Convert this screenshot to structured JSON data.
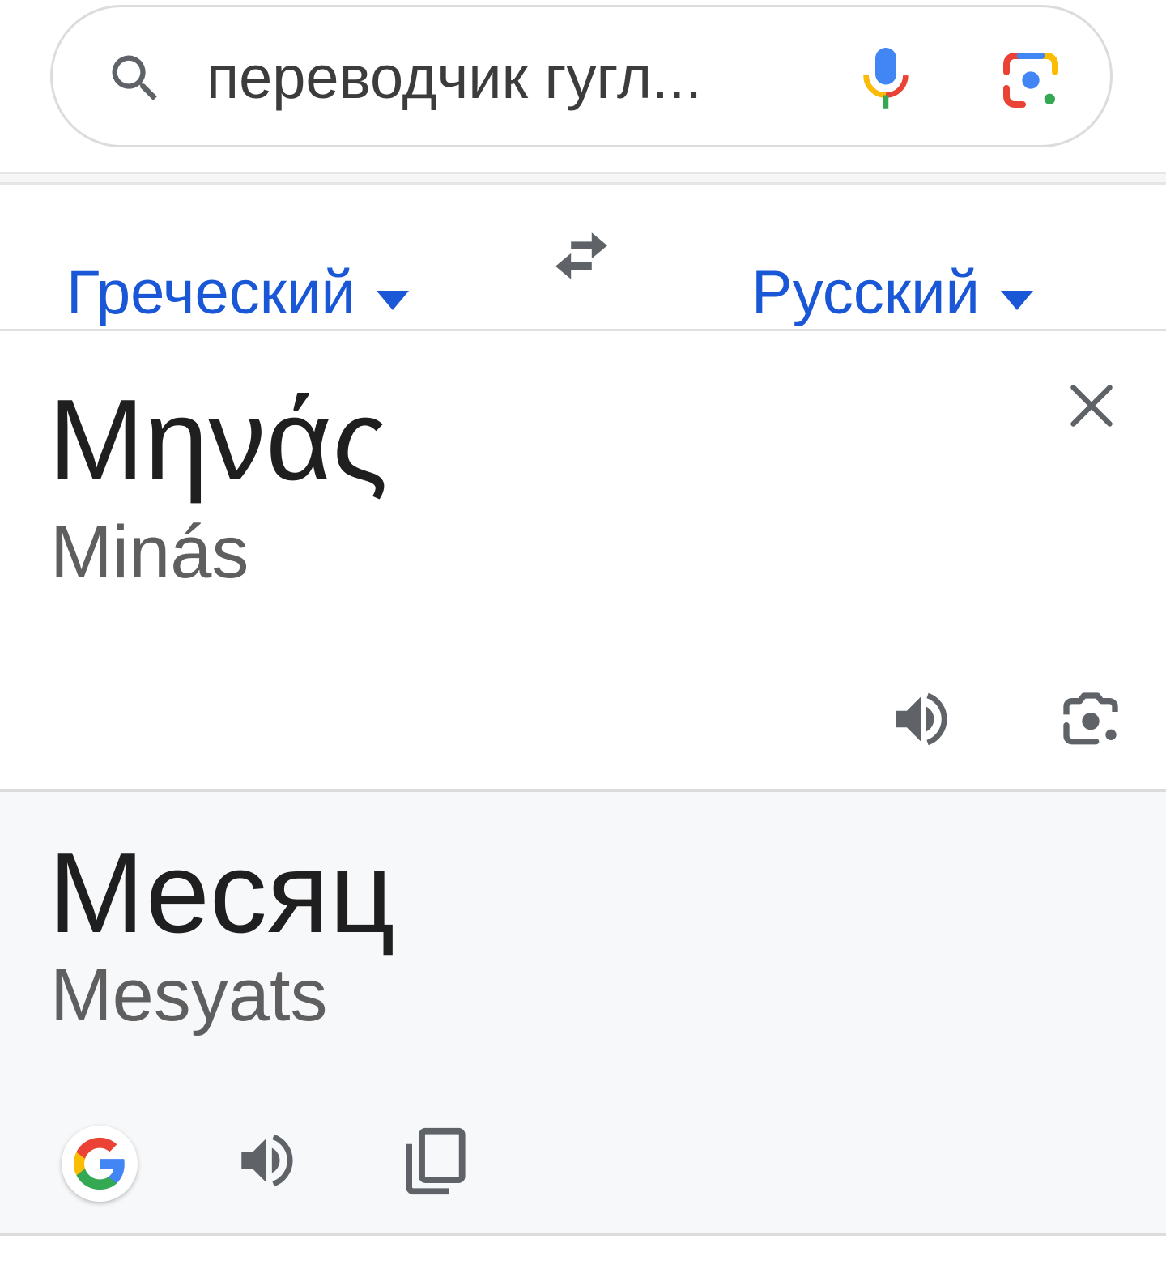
{
  "search": {
    "query": "переводчик гугл...",
    "icons": [
      "search-icon",
      "mic-icon",
      "lens-icon"
    ]
  },
  "languages": {
    "source": "Греческий",
    "target": "Русский",
    "swap_icon": "swap-icon",
    "accent_color": "#1a57d6"
  },
  "source": {
    "text": "Μηνάς",
    "transliteration": "Minás",
    "icons": [
      "close-icon",
      "speaker-icon",
      "camera-icon"
    ]
  },
  "target": {
    "text": "Месяц",
    "transliteration": "Mesyats",
    "icons": [
      "google-logo-icon",
      "speaker-icon",
      "copy-icon"
    ],
    "background": "#f7f8fa"
  }
}
